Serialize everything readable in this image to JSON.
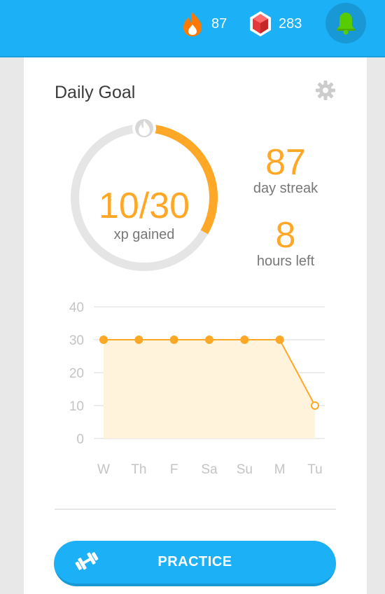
{
  "header": {
    "streak_count": "87",
    "gem_count": "283",
    "streak_icon_color": "#ff7900",
    "gem_icon_color": "#e53838",
    "bell_icon_color": "#58cc02"
  },
  "goal": {
    "title": "Daily Goal",
    "progress_value": "10/30",
    "progress_label": "xp gained",
    "progress_fraction": 0.333,
    "streak_value": "87",
    "streak_label": "day streak",
    "hours_value": "8",
    "hours_label": "hours left",
    "accent_color": "#ffa726"
  },
  "chart_data": {
    "type": "line",
    "categories": [
      "W",
      "Th",
      "F",
      "Sa",
      "Su",
      "M",
      "Tu"
    ],
    "values": [
      30,
      30,
      30,
      30,
      30,
      30,
      10
    ],
    "ylim": [
      0,
      40
    ],
    "yticks": [
      "0",
      "10",
      "20",
      "30",
      "40"
    ],
    "grid": true,
    "fill": true,
    "last_point_hollow": true
  },
  "practice_button": {
    "label": "PRACTICE"
  }
}
